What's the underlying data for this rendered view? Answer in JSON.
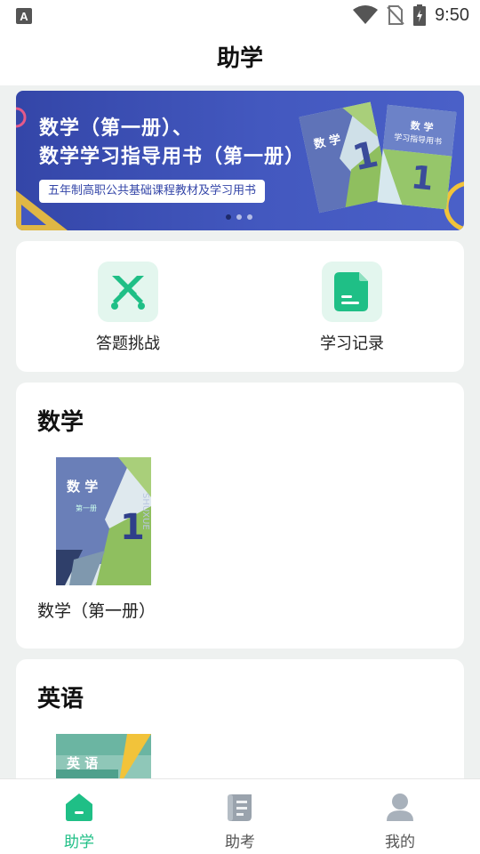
{
  "status_bar": {
    "time": "9:50",
    "left_badge": "A"
  },
  "header": {
    "title": "助学"
  },
  "banner": {
    "line1": "数学（第一册）、",
    "line2": "数学学习指导用书（第一册）",
    "tag": "五年制高职公共基础课程教材及学习用书",
    "book1_title": "数 学",
    "book2_title": "数 学",
    "book2_subtitle": "学习指导用书",
    "book_volume": "1"
  },
  "quick_actions": [
    {
      "label": "答题挑战",
      "icon": "crossed-swords-icon"
    },
    {
      "label": "学习记录",
      "icon": "document-icon"
    }
  ],
  "subjects": [
    {
      "title": "数学",
      "book": {
        "name": "数学（第一册）",
        "cover_title": "数 学",
        "cover_sub": "第一册",
        "volume": "1",
        "pinyin": "SHUXUE"
      }
    },
    {
      "title": "英语",
      "book": {
        "name": "",
        "cover_title": "英 语"
      }
    }
  ],
  "bottom_nav": [
    {
      "label": "助学",
      "icon": "home-icon",
      "active": true
    },
    {
      "label": "助考",
      "icon": "scroll-icon",
      "active": false
    },
    {
      "label": "我的",
      "icon": "user-icon",
      "active": false
    }
  ],
  "colors": {
    "accent": "#1fbf86",
    "banner": "#3f52b5",
    "background": "#eef1f0"
  }
}
